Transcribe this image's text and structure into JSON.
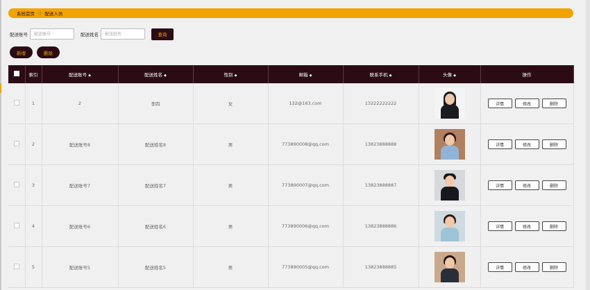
{
  "breadcrumb": {
    "home": "系统首页",
    "separator": "::",
    "current": "配送人员"
  },
  "search": {
    "account_label": "配送账号",
    "account_placeholder": "配送账号",
    "name_label": "配送姓名",
    "name_placeholder": "配送姓名",
    "submit_label": "查询"
  },
  "actions": {
    "add_label": "新增",
    "delete_label": "删除"
  },
  "table": {
    "columns": [
      "索引",
      "配送账号",
      "配送姓名",
      "性别",
      "邮箱",
      "联系手机",
      "头像",
      "操作"
    ],
    "row_buttons": {
      "detail": "详情",
      "edit": "修改",
      "delete": "删除"
    },
    "rows": [
      {
        "index": "1",
        "account": "2",
        "name": "李四",
        "gender": "女",
        "email": "132@163.com",
        "phone": "13222222222",
        "avatar": "avatar-photo"
      },
      {
        "index": "2",
        "account": "配送账号8",
        "name": "配送姓名8",
        "gender": "男",
        "email": "773890008@qq.com",
        "phone": "13823888888",
        "avatar": "avatar-photo"
      },
      {
        "index": "3",
        "account": "配送账号7",
        "name": "配送姓名7",
        "gender": "男",
        "email": "773890007@qq.com",
        "phone": "13823888887",
        "avatar": "avatar-photo"
      },
      {
        "index": "4",
        "account": "配送账号6",
        "name": "配送姓名6",
        "gender": "男",
        "email": "773890006@qq.com",
        "phone": "13823888886",
        "avatar": "avatar-photo"
      },
      {
        "index": "5",
        "account": "配送账号5",
        "name": "配送姓名5",
        "gender": "男",
        "email": "773890005@qq.com",
        "phone": "13823888885",
        "avatar": "avatar-photo"
      }
    ]
  },
  "colors": {
    "accent": "#f1a400",
    "dark": "#2b0b14",
    "page_bg": "#f0f0f0"
  }
}
